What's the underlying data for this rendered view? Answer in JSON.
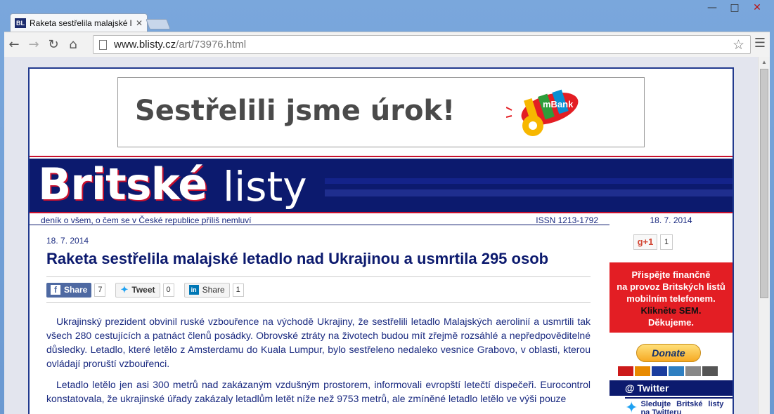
{
  "browser": {
    "tab_title": "Raketa sestřelila malajské l",
    "tab_favicon": "BL",
    "url_host": "www.blisty.cz",
    "url_path": "/art/73976.html"
  },
  "ad": {
    "text": "Sestřelili jsme úrok!",
    "brand": "mBank"
  },
  "site": {
    "logo_bold": "Britské",
    "logo_light": "listy",
    "tagline": "deník o všem, o čem se v České republice příliš nemluví",
    "issn": "ISSN 1213-1792"
  },
  "article": {
    "date": "18. 7. 2014",
    "title": "Raketa sestřelila malajské letadlo nad Ukrajinou a usmrtila 295 osob",
    "share": {
      "fb_label": "Share",
      "fb_count": "7",
      "tw_label": "Tweet",
      "tw_count": "0",
      "li_label": "Share",
      "li_count": "1"
    },
    "paragraphs": [
      "Ukrajinský prezident obvinil ruské vzbouřence na východě Ukrajiny, že sestřelili letadlo Malajských aerolinií a usmrtili tak všech 280 cestujících a patnáct členů posádky. Obrovské ztráty na životech budou mít zřejmě rozsáhlé a nepředpověditelné důsledky. Letadlo, které letělo z Amsterdamu do Kuala Lumpur, bylo sestřeleno nedaleko vesnice Grabovo, v oblasti, kterou ovládají proruští vzbouřenci.",
      "Letadlo letělo jen asi 300 metrů nad zakázaným vzdušným prostorem, informovali evropští letečtí dispečeři. Eurocontrol konstatovala, že ukrajinské úřady zakázaly letadlům letět níže než 9753 metrů, ale zmíněné letadlo letělo ve výši pouze"
    ]
  },
  "sidebar": {
    "date": "18. 7. 2014",
    "gplus_label": "g+1",
    "gplus_count": "1",
    "donate_lines": [
      "Přispějte finančně",
      "na provoz Britských listů",
      "mobilním telefonem."
    ],
    "donate_cta": "Klikněte SEM.",
    "donate_thanks": "Děkujeme.",
    "paypal_label": "Donate",
    "twitter_heading": "@ Twitter",
    "twitter_text": "Sledujte Britské listy na Twitteru"
  }
}
